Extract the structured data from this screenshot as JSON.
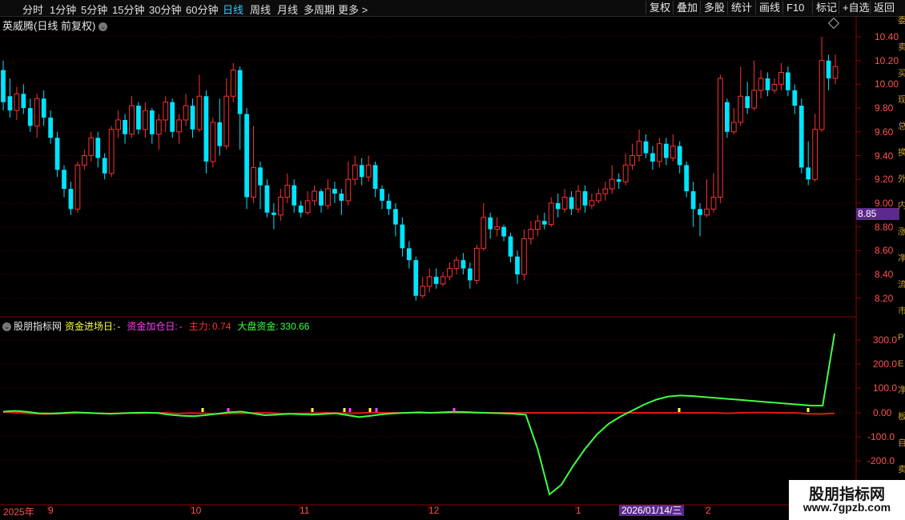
{
  "toolbar": {
    "periods": [
      "分时",
      "1分钟",
      "5分钟",
      "15分钟",
      "30分钟",
      "60分钟",
      "日线",
      "周线",
      "月线",
      "多周期",
      "更多 >"
    ],
    "active_period": "日线",
    "right_buttons": [
      "复权",
      "叠加",
      "多股",
      "统计",
      "画线",
      "F10",
      "标记",
      "+自选",
      "返回"
    ]
  },
  "main_panel": {
    "title": "英威腾(日线 前复权)",
    "y_ticks": [
      "10.40",
      "10.20",
      "10.00",
      "9.80",
      "9.60",
      "9.40",
      "9.20",
      "9.00",
      "8.80",
      "8.60",
      "8.40",
      "8.20"
    ],
    "current_price": "8.85"
  },
  "indicator_panel": {
    "name": "股朋指标网",
    "fields": [
      {
        "label": "资金进场日:",
        "value": "-",
        "color": "#ffff40"
      },
      {
        "label": "资金加仓日:",
        "value": "-",
        "color": "#ff40ff"
      },
      {
        "label": "主力:",
        "value": "0.74",
        "color": "#ff3030"
      },
      {
        "label": "大盘资金:",
        "value": "330.66",
        "color": "#40ff40"
      }
    ],
    "y_ticks": [
      "300.0",
      "200.0",
      "100.0",
      "0.00",
      "-100.0",
      "-200.0"
    ]
  },
  "x_axis": {
    "labels": [
      "2025年",
      "9",
      "10",
      "11",
      "12",
      "1",
      "2"
    ],
    "cursor_date": "2026/01/14/三"
  },
  "right_strip_text": "委卖买现总换外内涨净流市PE净板自卖买",
  "watermark": {
    "title": "股朋指标网",
    "url": "www.7gpzb.com"
  },
  "colors": {
    "up": "#ff3030",
    "down": "#00e5ff",
    "main_line": "#e01818",
    "fund_line": "#40ff40",
    "axis": "#8b0000"
  },
  "chart_data": [
    {
      "type": "candlestick",
      "title": "英威腾(日线 前复权)",
      "ylim": [
        8.12,
        10.5
      ],
      "candles": [
        [
          10.12,
          9.85,
          10.2,
          9.78
        ],
        [
          9.9,
          9.78,
          10.05,
          9.72
        ],
        [
          9.78,
          9.92,
          9.98,
          9.7
        ],
        [
          9.92,
          9.8,
          10.0,
          9.75
        ],
        [
          9.8,
          9.65,
          9.88,
          9.6
        ],
        [
          9.65,
          9.88,
          9.92,
          9.55
        ],
        [
          9.88,
          9.72,
          9.95,
          9.65
        ],
        [
          9.72,
          9.55,
          9.78,
          9.5
        ],
        [
          9.55,
          9.28,
          9.6,
          9.22
        ],
        [
          9.28,
          9.12,
          9.32,
          9.05
        ],
        [
          9.12,
          8.95,
          9.18,
          8.9
        ],
        [
          8.95,
          9.32,
          9.35,
          8.92
        ],
        [
          9.32,
          9.4,
          9.45,
          9.28
        ],
        [
          9.4,
          9.55,
          9.6,
          9.35
        ],
        [
          9.55,
          9.38,
          9.6,
          9.3
        ],
        [
          9.38,
          9.25,
          9.42,
          9.2
        ],
        [
          9.25,
          9.62,
          9.65,
          9.22
        ],
        [
          9.62,
          9.7,
          9.78,
          9.55
        ],
        [
          9.7,
          9.58,
          9.75,
          9.5
        ],
        [
          9.58,
          9.82,
          9.9,
          9.55
        ],
        [
          9.82,
          9.62,
          9.85,
          9.58
        ],
        [
          9.62,
          9.78,
          9.85,
          9.55
        ],
        [
          9.78,
          9.58,
          9.8,
          9.5
        ],
        [
          9.58,
          9.7,
          9.75,
          9.45
        ],
        [
          9.7,
          9.85,
          9.9,
          9.6
        ],
        [
          9.85,
          9.6,
          9.88,
          9.55
        ],
        [
          9.6,
          9.7,
          9.75,
          9.5
        ],
        [
          9.7,
          9.82,
          9.92,
          9.65
        ],
        [
          9.82,
          9.62,
          9.88,
          9.55
        ],
        [
          9.62,
          9.9,
          10.08,
          9.6
        ],
        [
          9.9,
          9.35,
          9.95,
          9.25
        ],
        [
          9.35,
          9.68,
          9.72,
          9.3
        ],
        [
          9.68,
          9.48,
          9.88,
          9.4
        ],
        [
          9.48,
          9.9,
          10.05,
          9.45
        ],
        [
          9.9,
          10.12,
          10.18,
          9.85
        ],
        [
          10.12,
          9.75,
          10.15,
          9.45
        ],
        [
          9.75,
          9.05,
          9.8,
          8.95
        ],
        [
          9.05,
          9.3,
          9.65,
          9.0
        ],
        [
          9.3,
          9.15,
          9.35,
          8.95
        ],
        [
          9.15,
          8.92,
          9.2,
          8.88
        ],
        [
          8.92,
          8.9,
          9.0,
          8.78
        ],
        [
          8.9,
          9.05,
          9.12,
          8.85
        ],
        [
          9.05,
          9.15,
          9.25,
          9.0
        ],
        [
          9.15,
          8.98,
          9.2,
          8.92
        ],
        [
          8.98,
          8.92,
          9.02,
          8.88
        ],
        [
          8.92,
          9.02,
          9.1,
          8.9
        ],
        [
          9.02,
          9.1,
          9.15,
          8.98
        ],
        [
          9.1,
          8.98,
          9.12,
          8.92
        ],
        [
          8.98,
          9.12,
          9.2,
          8.95
        ],
        [
          9.12,
          9.08,
          9.18,
          9.0
        ],
        [
          9.08,
          9.02,
          9.12,
          8.9
        ],
        [
          9.02,
          9.2,
          9.35,
          8.98
        ],
        [
          9.2,
          9.32,
          9.4,
          9.15
        ],
        [
          9.32,
          9.22,
          9.38,
          9.15
        ],
        [
          9.22,
          9.32,
          9.4,
          9.18
        ],
        [
          9.32,
          9.12,
          9.35,
          9.05
        ],
        [
          9.12,
          9.02,
          9.15,
          8.95
        ],
        [
          9.02,
          8.95,
          9.08,
          8.9
        ],
        [
          8.95,
          8.82,
          9.0,
          8.72
        ],
        [
          8.82,
          8.62,
          8.88,
          8.55
        ],
        [
          8.62,
          8.52,
          8.68,
          8.45
        ],
        [
          8.52,
          8.22,
          8.55,
          8.18
        ],
        [
          8.22,
          8.3,
          8.38,
          8.2
        ],
        [
          8.3,
          8.38,
          8.45,
          8.25
        ],
        [
          8.38,
          8.32,
          8.45,
          8.28
        ],
        [
          8.32,
          8.38,
          8.42,
          8.3
        ],
        [
          8.38,
          8.45,
          8.5,
          8.35
        ],
        [
          8.45,
          8.52,
          8.55,
          8.4
        ],
        [
          8.52,
          8.45,
          8.58,
          8.4
        ],
        [
          8.45,
          8.35,
          8.5,
          8.28
        ],
        [
          8.35,
          8.62,
          8.65,
          8.32
        ],
        [
          8.62,
          8.88,
          9.0,
          8.6
        ],
        [
          8.88,
          8.78,
          8.92,
          8.7
        ],
        [
          8.78,
          8.8,
          8.88,
          8.72
        ],
        [
          8.8,
          8.72,
          8.82,
          8.68
        ],
        [
          8.72,
          8.55,
          8.75,
          8.5
        ],
        [
          8.55,
          8.4,
          8.6,
          8.32
        ],
        [
          8.4,
          8.7,
          8.78,
          8.35
        ],
        [
          8.7,
          8.78,
          8.85,
          8.65
        ],
        [
          8.78,
          8.85,
          8.9,
          8.72
        ],
        [
          8.85,
          8.82,
          8.92,
          8.78
        ],
        [
          8.82,
          9.0,
          9.05,
          8.8
        ],
        [
          9.0,
          8.95,
          9.08,
          8.88
        ],
        [
          8.95,
          9.05,
          9.12,
          8.92
        ],
        [
          9.05,
          8.95,
          9.1,
          8.9
        ],
        [
          8.95,
          9.1,
          9.15,
          8.92
        ],
        [
          9.1,
          8.98,
          9.15,
          8.92
        ],
        [
          8.98,
          9.02,
          9.08,
          8.95
        ],
        [
          9.02,
          9.08,
          9.12,
          9.0
        ],
        [
          9.08,
          9.12,
          9.18,
          9.02
        ],
        [
          9.12,
          9.2,
          9.32,
          9.08
        ],
        [
          9.2,
          9.18,
          9.25,
          9.12
        ],
        [
          9.18,
          9.32,
          9.42,
          9.15
        ],
        [
          9.32,
          9.4,
          9.5,
          9.28
        ],
        [
          9.4,
          9.52,
          9.62,
          9.35
        ],
        [
          9.52,
          9.42,
          9.58,
          9.38
        ],
        [
          9.42,
          9.35,
          9.48,
          9.28
        ],
        [
          9.35,
          9.5,
          9.55,
          9.3
        ],
        [
          9.5,
          9.38,
          9.55,
          9.32
        ],
        [
          9.38,
          9.48,
          9.58,
          9.35
        ],
        [
          9.48,
          9.32,
          9.52,
          9.25
        ],
        [
          9.32,
          9.1,
          9.35,
          9.05
        ],
        [
          9.1,
          8.95,
          9.18,
          8.8
        ],
        [
          8.95,
          8.9,
          9.0,
          8.72
        ],
        [
          8.9,
          8.95,
          9.2,
          8.88
        ],
        [
          8.95,
          9.05,
          9.25,
          8.92
        ],
        [
          9.05,
          10.05,
          10.08,
          9.0
        ],
        [
          9.85,
          9.6,
          9.88,
          9.55
        ],
        [
          9.6,
          9.68,
          9.8,
          9.58
        ],
        [
          9.68,
          9.9,
          10.15,
          9.65
        ],
        [
          9.9,
          9.8,
          10.02,
          9.75
        ],
        [
          9.8,
          9.95,
          10.2,
          9.78
        ],
        [
          9.95,
          10.05,
          10.12,
          9.88
        ],
        [
          10.05,
          9.95,
          10.1,
          9.9
        ],
        [
          9.95,
          10.0,
          10.05,
          9.92
        ],
        [
          10.0,
          10.1,
          10.18,
          9.95
        ],
        [
          10.1,
          9.95,
          10.15,
          9.9
        ],
        [
          9.95,
          9.82,
          10.0,
          9.75
        ],
        [
          9.82,
          9.3,
          9.88,
          9.25
        ],
        [
          9.3,
          9.2,
          9.52,
          9.15
        ],
        [
          9.2,
          9.62,
          9.75,
          9.18
        ],
        [
          9.62,
          10.2,
          10.4,
          9.6
        ],
        [
          10.2,
          10.05,
          10.25,
          9.95
        ],
        [
          10.05,
          10.15,
          10.25,
          10.0
        ]
      ]
    },
    {
      "type": "line",
      "title": "股朋指标网",
      "ylim": [
        -365,
        345
      ],
      "series": [
        {
          "name": "主力",
          "color": "#e01818",
          "values": [
            3,
            0,
            -3,
            -5,
            -4,
            -2,
            0,
            -2,
            -3,
            -1,
            -2,
            -1,
            0,
            -3,
            -1,
            -2,
            -5,
            -3,
            -2,
            0,
            -1,
            -4,
            -3,
            -2,
            0,
            -1,
            -2,
            0,
            0,
            0,
            0,
            0,
            0,
            0,
            0,
            0,
            0,
            0,
            0,
            0,
            0,
            0,
            0,
            0,
            -1,
            0,
            0,
            0,
            0,
            0,
            0,
            0,
            0,
            0,
            -2,
            0,
            1,
            1,
            0,
            0,
            -4,
            -5,
            -2
          ]
        },
        {
          "name": "大盘资金",
          "color": "#40ff40",
          "values": [
            5,
            8,
            4,
            -2,
            -3,
            -1,
            2,
            0,
            -2,
            -4,
            -2,
            0,
            1,
            -1,
            -8,
            -12,
            -14,
            -10,
            -4,
            2,
            5,
            -2,
            -10,
            -8,
            -4,
            -6,
            -8,
            -5,
            -2,
            -10,
            -18,
            -12,
            -6,
            -2,
            0,
            2,
            0,
            2,
            4,
            3,
            1,
            -1,
            -2,
            -4,
            -8,
            -150,
            -340,
            -300,
            -220,
            -150,
            -90,
            -45,
            -15,
            10,
            35,
            55,
            68,
            72,
            70,
            66,
            62,
            58,
            54,
            50,
            46,
            42,
            38,
            34,
            30,
            30,
            330
          ]
        }
      ]
    }
  ]
}
